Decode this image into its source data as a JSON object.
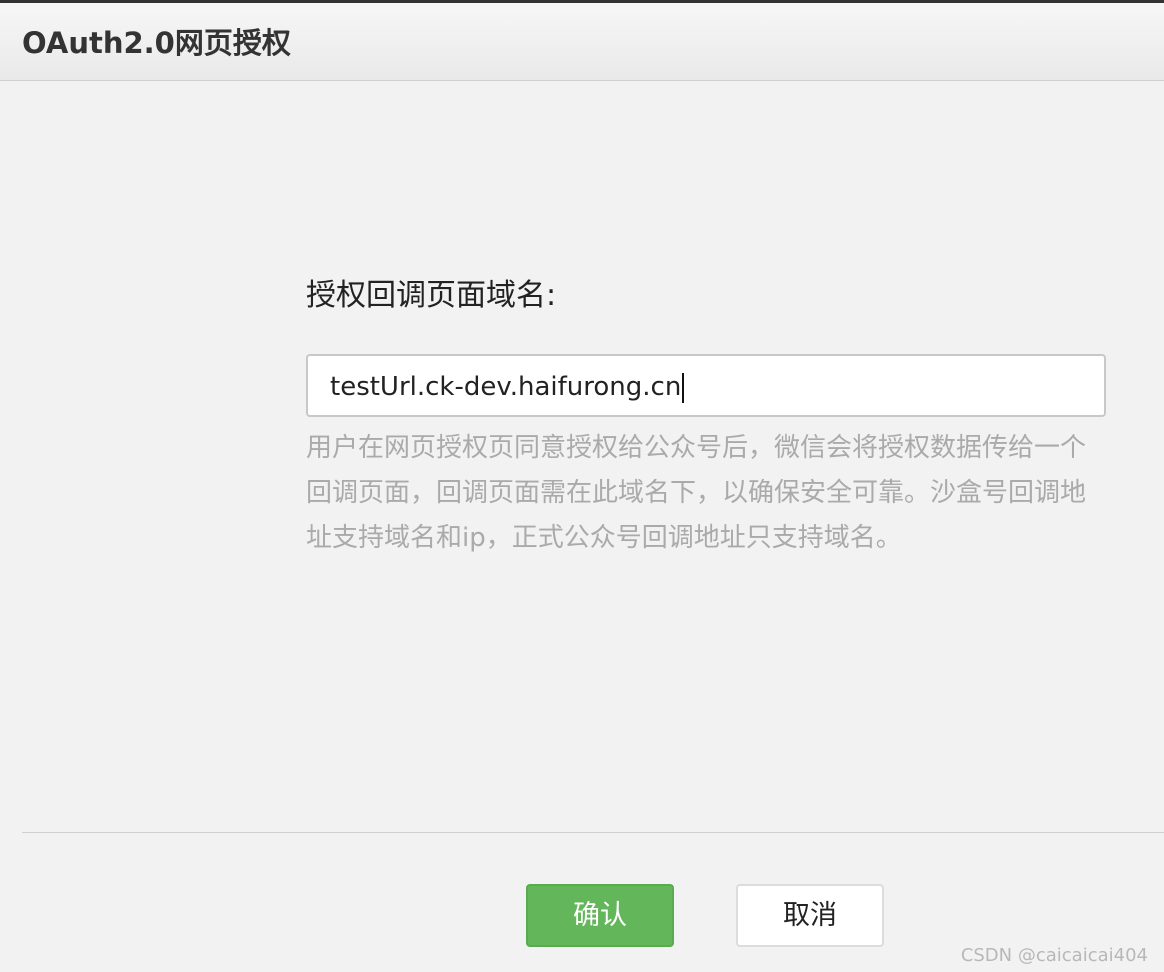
{
  "dialog": {
    "title": "OAuth2.0网页授权"
  },
  "form": {
    "field_label": "授权回调页面域名:",
    "url_value": "testUrl.ck-dev.haifurong.cn",
    "help_text": "用户在网页授权页同意授权给公众号后，微信会将授权数据传给一个回调页面，回调页面需在此域名下，以确保安全可靠。沙盒号回调地址支持域名和ip，正式公众号回调地址只支持域名。"
  },
  "footer": {
    "confirm_label": "确认",
    "cancel_label": "取消"
  },
  "watermark": "CSDN @caicaicai404",
  "colors": {
    "confirm_button": "#64b65a",
    "help_text": "#aaaaaa",
    "background": "#f2f2f2"
  }
}
